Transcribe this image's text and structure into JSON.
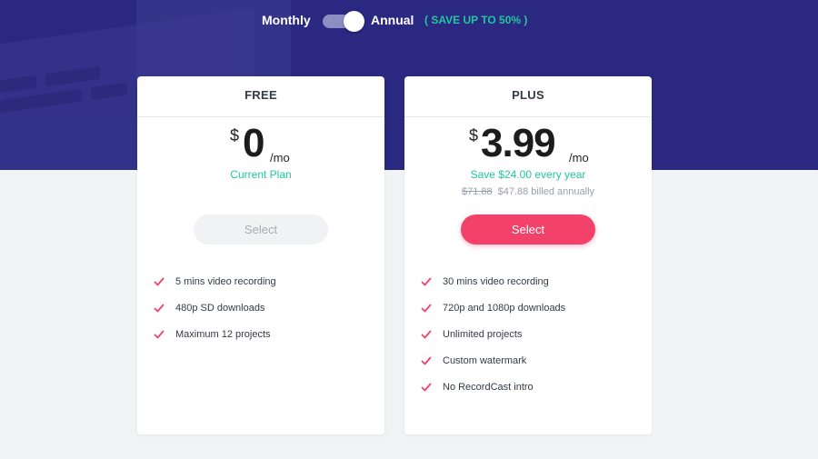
{
  "billing_toggle": {
    "monthly_label": "Monthly",
    "annual_label": "Annual",
    "save_note": "( SAVE UP TO 50% )",
    "selected": "Annual"
  },
  "colors": {
    "hero_bg": "#2a2880",
    "accent_green": "#22c7a0",
    "accent_pink": "#f2426a"
  },
  "plans": [
    {
      "name": "FREE",
      "currency": "$",
      "price": "0",
      "period": "/mo",
      "note": "Current Plan",
      "button_label": "Select",
      "features": [
        "5 mins video recording",
        "480p SD downloads",
        "Maximum 12 projects"
      ]
    },
    {
      "name": "PLUS",
      "currency": "$",
      "price": "3.99",
      "period": "/mo",
      "note": "Save $24.00 every year",
      "original_price": "$71.88",
      "billed": "$47.88 billed annually",
      "button_label": "Select",
      "features": [
        "30 mins video recording",
        "720p and 1080p downloads",
        "Unlimited projects",
        "Custom watermark",
        "No RecordCast intro"
      ]
    }
  ],
  "icons": {
    "feature_bullet": "check-icon"
  }
}
